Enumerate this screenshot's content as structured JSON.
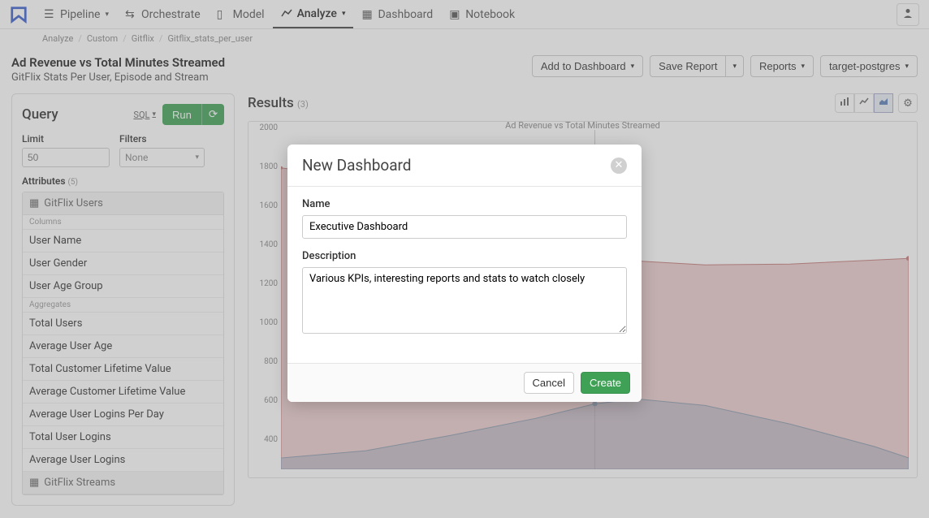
{
  "nav": {
    "pipeline": "Pipeline",
    "orchestrate": "Orchestrate",
    "model": "Model",
    "analyze": "Analyze",
    "dashboard": "Dashboard",
    "notebook": "Notebook"
  },
  "breadcrumb": [
    "Analyze",
    "Custom",
    "Gitflix",
    "Gitflix_stats_per_user"
  ],
  "page": {
    "title": "Ad Revenue vs Total Minutes Streamed",
    "subtitle": "GitFlix Stats Per User, Episode and Stream"
  },
  "actions": {
    "add_dashboard": "Add to Dashboard",
    "save_report": "Save Report",
    "reports": "Reports",
    "target": "target-postgres"
  },
  "query": {
    "title": "Query",
    "sql": "SQL",
    "run": "Run",
    "limit_label": "Limit",
    "limit_placeholder": "50",
    "filters_label": "Filters",
    "filters_value": "None",
    "attributes_label": "Attributes",
    "attributes_count": "(5)",
    "group1_title": "GitFlix Users",
    "columns_label": "Columns",
    "columns": [
      "User Name",
      "User Gender",
      "User Age Group"
    ],
    "aggregates_label": "Aggregates",
    "aggregates": [
      "Total Users",
      "Average User Age",
      "Total Customer Lifetime Value",
      "Average Customer Lifetime Value",
      "Average User Logins Per Day",
      "Total User Logins",
      "Average User Logins"
    ],
    "group2_title": "GitFlix Streams"
  },
  "results": {
    "title": "Results",
    "count": "(3)",
    "chart_legend": "Ad Revenue vs Total Minutes Streamed"
  },
  "chart_data": {
    "type": "area",
    "ylim": [
      200,
      2000
    ],
    "yticks": [
      2000,
      1800,
      1600,
      1400,
      1200,
      1000,
      800,
      600,
      400
    ],
    "series": [
      {
        "name": "series-red",
        "color": "#d89b9b",
        "points": [
          [
            0,
            1800
          ],
          [
            50,
            1770
          ],
          [
            100,
            1660
          ],
          [
            200,
            1480
          ],
          [
            300,
            1370
          ],
          [
            400,
            1310
          ],
          [
            500,
            1285
          ],
          [
            600,
            1290
          ],
          [
            700,
            1310
          ],
          [
            740,
            1320
          ]
        ]
      },
      {
        "name": "series-blue",
        "color": "#a8b4c2",
        "points": [
          [
            0,
            260
          ],
          [
            100,
            300
          ],
          [
            200,
            380
          ],
          [
            300,
            470
          ],
          [
            370,
            550
          ],
          [
            420,
            575
          ],
          [
            500,
            540
          ],
          [
            600,
            440
          ],
          [
            700,
            320
          ],
          [
            740,
            260
          ]
        ]
      }
    ]
  },
  "modal": {
    "title": "New Dashboard",
    "name_label": "Name",
    "name_value": "Executive Dashboard",
    "desc_label": "Description",
    "desc_value": "Various KPIs, interesting reports and stats to watch closely",
    "cancel": "Cancel",
    "create": "Create"
  }
}
